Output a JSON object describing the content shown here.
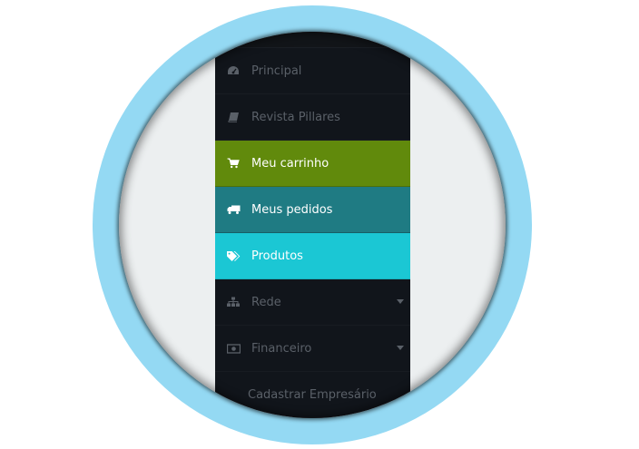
{
  "colors": {
    "ring": "#94d9f3",
    "disc": "#eceff0",
    "menu_bg": "#11151b",
    "text_dim": "#5a6068",
    "green": "#618a0c",
    "teal": "#1f7b83",
    "cyan": "#1bc7d4"
  },
  "menu": {
    "items": [
      {
        "label": "Principal",
        "icon": "dashboard-icon",
        "state": "default",
        "has_submenu": false
      },
      {
        "label": "Revista Pillares",
        "icon": "book-icon",
        "state": "default",
        "has_submenu": false
      },
      {
        "label": "Meu carrinho",
        "icon": "shopping-cart-icon",
        "state": "highlight-green",
        "has_submenu": false
      },
      {
        "label": "Meus pedidos",
        "icon": "truck-icon",
        "state": "highlight-teal",
        "has_submenu": false
      },
      {
        "label": "Produtos",
        "icon": "tags-icon",
        "state": "highlight-cyan",
        "has_submenu": false
      },
      {
        "label": "Rede",
        "icon": "sitemap-icon",
        "state": "default",
        "has_submenu": true
      },
      {
        "label": "Financeiro",
        "icon": "money-icon",
        "state": "default",
        "has_submenu": true
      },
      {
        "label": "Cadastrar Empresário",
        "icon": "",
        "state": "default",
        "has_submenu": false
      }
    ]
  }
}
